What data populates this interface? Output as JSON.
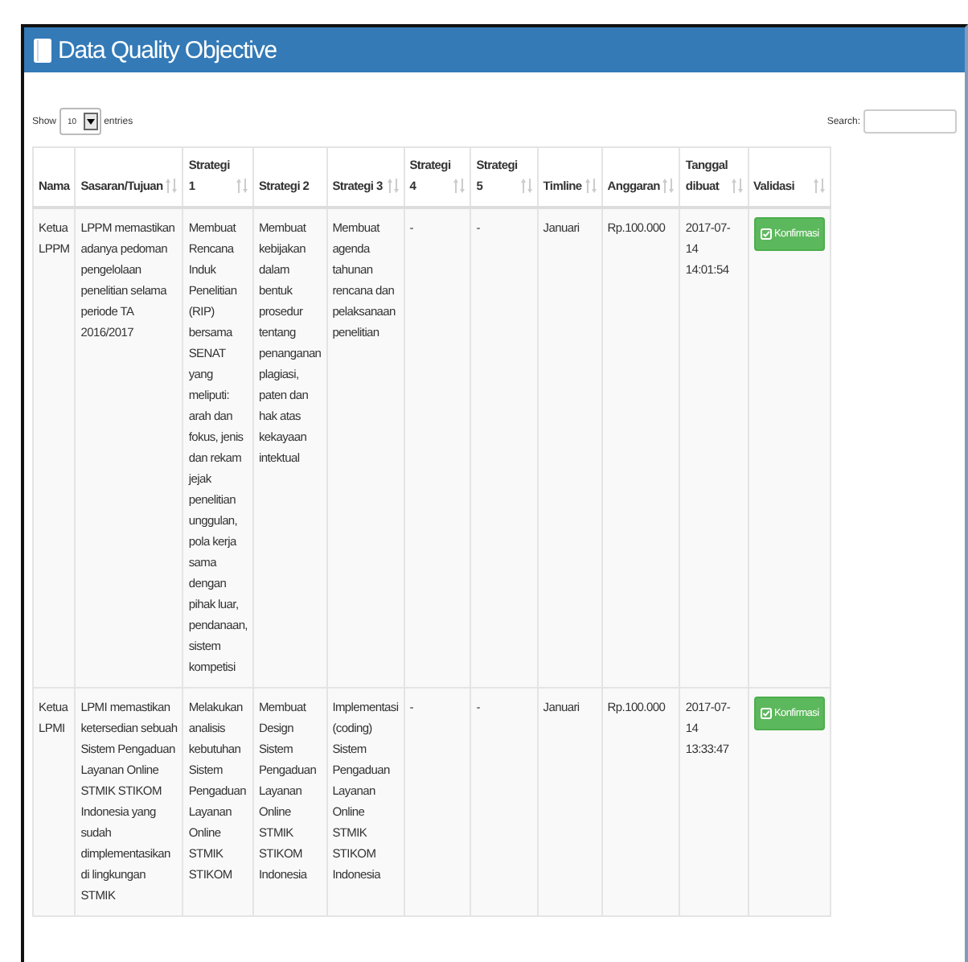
{
  "panel": {
    "title": "Data Quality Objective"
  },
  "length_control": {
    "label_before": "Show",
    "value": "10",
    "label_after": "entries"
  },
  "search": {
    "label": "Search:"
  },
  "table": {
    "columns": [
      {
        "label": "Nama",
        "sortable": false
      },
      {
        "label": "Sasaran/Tujuan",
        "sortable": true
      },
      {
        "label": "Strategi 1",
        "sortable": true
      },
      {
        "label": "Strategi 2",
        "sortable": false
      },
      {
        "label": "Strategi 3",
        "sortable": true
      },
      {
        "label": "Strategi 4",
        "sortable": true
      },
      {
        "label": "Strategi 5",
        "sortable": true
      },
      {
        "label": "Timline",
        "sortable": true
      },
      {
        "label": "Anggaran",
        "sortable": true
      },
      {
        "label": "Tanggal dibuat",
        "sortable": true
      },
      {
        "label": "Validasi",
        "sortable": true
      }
    ],
    "rows": [
      {
        "cells": [
          "Ketua LPPM",
          "LPPM memastikan adanya pedoman pengelolaan penelitian selama periode TA 2016/2017",
          "Membuat Rencana Induk Penelitian (RIP) bersama SENAT yang meliputi: arah dan fokus, jenis dan rekam jejak penelitian unggulan, pola kerja sama dengan pihak luar, pendanaan, sistem kompetisi",
          "Membuat kebijakan dalam bentuk prosedur tentang penanganan plagiasi, paten dan hak atas kekayaan intektual",
          "Membuat agenda tahunan rencana dan pelaksanaan penelitian",
          "-",
          "-",
          "Januari",
          "Rp.100.000",
          "2017-07-14 14:01:54"
        ],
        "button": "Konfirmasi"
      },
      {
        "cells": [
          "Ketua LPMI",
          "LPMI memastikan ketersedian sebuah Sistem Pengaduan Layanan Online STMIK STIKOM Indonesia yang sudah dimplementasikan di lingkungan STMIK",
          "Melakukan analisis kebutuhan Sistem Pengaduan Layanan Online STMIK STIKOM",
          "Membuat Design Sistem Pengaduan Layanan Online STMIK STIKOM Indonesia",
          "Implementasi (coding) Sistem Pengaduan Layanan Online STMIK STIKOM Indonesia",
          "-",
          "-",
          "Januari",
          "Rp.100.000",
          "2017-07-14 13:33:47"
        ],
        "button": "Konfirmasi"
      }
    ]
  }
}
